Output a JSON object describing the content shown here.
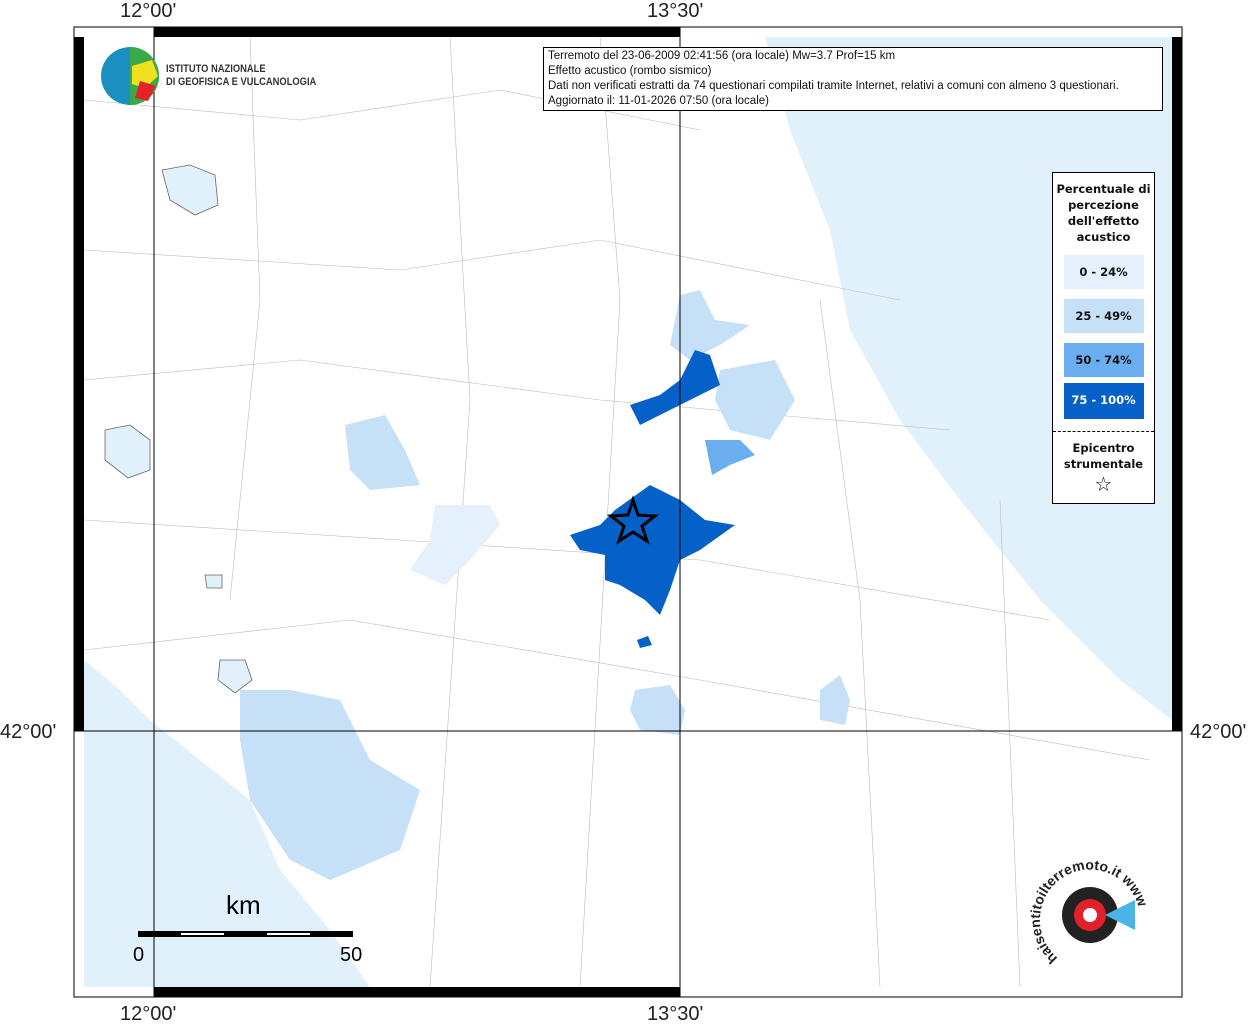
{
  "axes": {
    "lon_labels": [
      "12°00'",
      "13°30'"
    ],
    "lat_label": "42°00'"
  },
  "logo": {
    "line1": "ISTITUTO NAZIONALE",
    "line2": "DI GEOFISICA E VULCANOLOGIA"
  },
  "info": {
    "line1": "Terremoto del 23-06-2009 02:41:56 (ora locale) Mw=3.7 Prof=15 km",
    "line2": "Effetto acustico (rombo sismico)",
    "line3": "Dati non verificati estratti da 74 questionari compilati tramite Internet, relativi a comuni con almeno 3 questionari.",
    "line4": "Aggiornato il: 11-01-2026 07:50 (ora locale)"
  },
  "legend": {
    "title": "Percentuale di percezione dell'effetto acustico",
    "classes": [
      {
        "label": "0 - 24%",
        "color": "#e4f1fc"
      },
      {
        "label": "25 - 49%",
        "color": "#c6e0f8"
      },
      {
        "label": "50 - 74%",
        "color": "#6aaef0"
      },
      {
        "label": "75 - 100%",
        "color": "#0561c8"
      }
    ],
    "epicenter": "Epicentro strumentale"
  },
  "scale": {
    "unit": "km",
    "min": "0",
    "max": "50"
  },
  "watermark": "haisentitoilterremoto.it www"
}
